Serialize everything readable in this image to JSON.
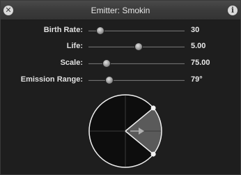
{
  "window": {
    "title": "Emitter: Smokin",
    "close_icon": "close-icon",
    "info_icon": "info-icon"
  },
  "controls": [
    {
      "label": "Birth Rate:",
      "value": "30",
      "fraction": 0.12
    },
    {
      "label": "Life:",
      "value": "5.00",
      "fraction": 0.52
    },
    {
      "label": "Scale:",
      "value": "75.00",
      "fraction": 0.19
    },
    {
      "label": "Emission Range:",
      "value": "79°",
      "fraction": 0.22
    }
  ],
  "emission": {
    "range_degrees": 79,
    "direction_degrees": 0
  },
  "colors": {
    "dial_fill": "#0d0d0d",
    "dial_stroke": "#f2f2f2",
    "wedge_fill": "#5a5a5a"
  }
}
